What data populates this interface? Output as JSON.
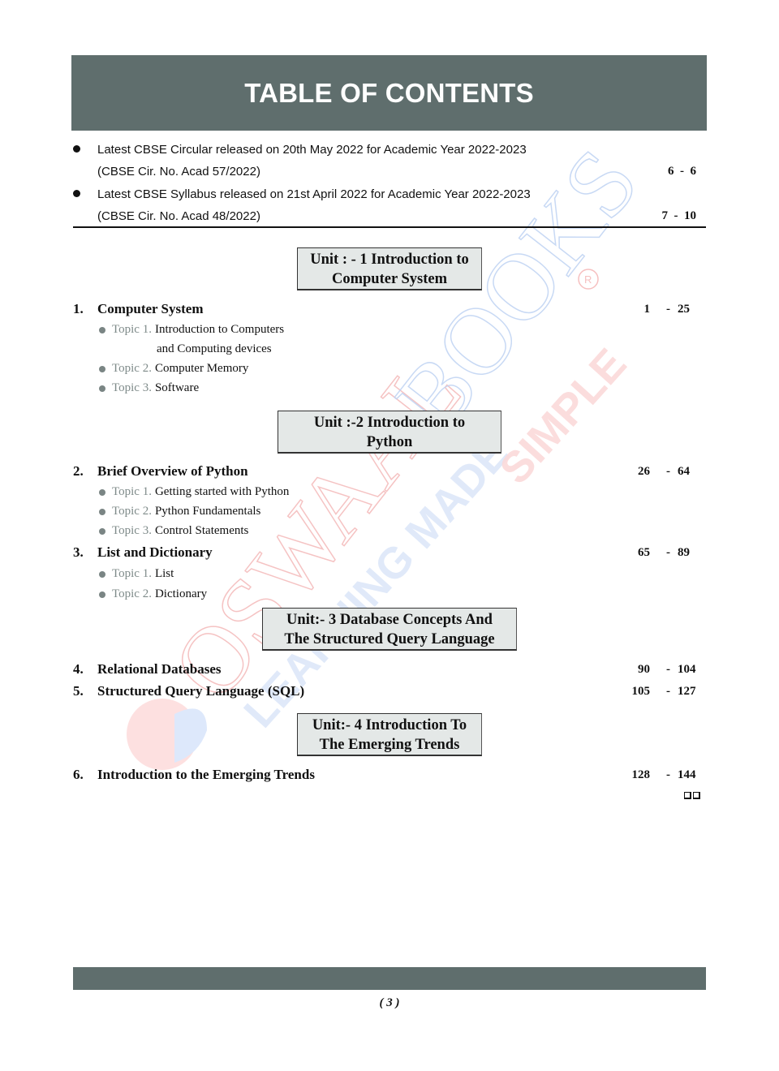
{
  "header": {
    "title": "TABLE OF CONTENTS"
  },
  "circulars": [
    {
      "line1": "Latest CBSE Circular released on 20th May 2022 for Academic Year 2022-2023",
      "line2": "(CBSE Cir. No. Acad 57/2022)",
      "pages": "6  -  6"
    },
    {
      "line1": "Latest CBSE Syllabus released on 21st April 2022 for Academic Year 2022-2023",
      "line2": "(CBSE Cir. No. Acad 48/2022)",
      "pages": "7  -  10"
    }
  ],
  "units": [
    {
      "line1": "Unit : - 1 Introduction to",
      "line2": "Computer System"
    },
    {
      "line1": "Unit :-2 Introduction to",
      "line2": "Python"
    },
    {
      "line1": "Unit:- 3 Database Concepts And",
      "line2": "The Structured Query Language"
    },
    {
      "line1": "Unit:- 4 Introduction To",
      "line2": "The Emerging Trends"
    }
  ],
  "chapters": [
    {
      "num": "1.",
      "title": "Computer System",
      "start": "1",
      "dash": "-",
      "end": "25",
      "topics": [
        {
          "label": "Topic 1.",
          "title": "Introduction to Computers",
          "cont": "and Computing devices"
        },
        {
          "label": "Topic 2.",
          "title": "Computer Memory"
        },
        {
          "label": "Topic 3.",
          "title": "Software"
        }
      ]
    },
    {
      "num": "2.",
      "title": "Brief Overview of Python",
      "start": "26",
      "dash": "-",
      "end": "64",
      "topics": [
        {
          "label": "Topic 1.",
          "title": "Getting started with Python"
        },
        {
          "label": "Topic 2.",
          "title": "Python Fundamentals"
        },
        {
          "label": "Topic 3.",
          "title": "Control Statements"
        }
      ]
    },
    {
      "num": "3.",
      "title": "List and Dictionary",
      "start": "65",
      "dash": "-",
      "end": "89",
      "topics": [
        {
          "label": "Topic 1.",
          "title": "List"
        },
        {
          "label": "Topic 2.",
          "title": "Dictionary"
        }
      ]
    },
    {
      "num": "4.",
      "title": "Relational Databases",
      "start": "90",
      "dash": "-",
      "end": "104",
      "topics": []
    },
    {
      "num": "5.",
      "title": "Structured Query Language (SQL)",
      "start": "105",
      "dash": "-",
      "end": "127",
      "topics": []
    },
    {
      "num": "6.",
      "title": "Introduction to the Emerging Trends",
      "start": "128",
      "dash": "-",
      "end": "144",
      "topics": []
    }
  ],
  "watermark": {
    "brand": "OSWAAL BOOKS",
    "tagline": "LEARNING MADE SIMPLE",
    "registered": "®"
  },
  "footer": {
    "page_number": "( 3 )"
  },
  "colors": {
    "header_bar": "#5f6e6d",
    "unit_box_bg": "#e4e8e7",
    "topic_label": "#7f8b8a",
    "watermark_red": "#f5b5b5",
    "watermark_blue": "#b7cff3"
  }
}
